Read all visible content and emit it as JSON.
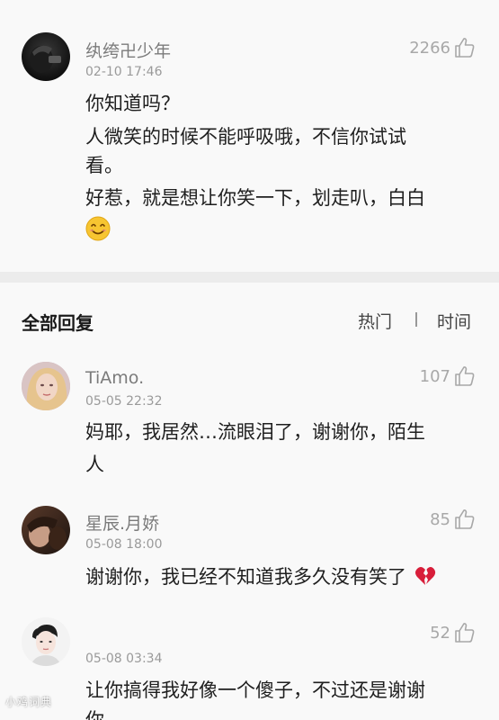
{
  "featured_comment": {
    "username": "纨绔卍少年",
    "timestamp": "02-10 17:46",
    "likes": "2266",
    "lines": [
      "你知道吗？",
      "人微笑的时候不能呼吸哦，不信你试试",
      "看。",
      "好惹，就是想让你笑一下，划走叭，白白"
    ],
    "emoji": "smile-emoji"
  },
  "section": {
    "title": "全部回复",
    "sort_hot": "热门",
    "sort_time": "时间"
  },
  "replies": [
    {
      "username": "TiAmo.",
      "timestamp": "05-05 22:32",
      "likes": "107",
      "lines": [
        "妈耶，我居然…流眼泪了，谢谢你，陌生",
        "人"
      ]
    },
    {
      "username": "星辰.月娇",
      "timestamp": "05-08 18:00",
      "likes": "85",
      "lines": [
        "谢谢你，我已经不知道我多久没有笑了"
      ],
      "emoji": "broken-heart-emoji"
    },
    {
      "username": "",
      "timestamp": "05-08 03:34",
      "likes": "52",
      "lines": [
        "让你搞得我好像一个傻子，不过还是谢谢",
        "你"
      ]
    }
  ],
  "watermark": "小鸡词典",
  "colors": {
    "background": "#f9f9f9",
    "divider": "#ececec",
    "muted_text": "#7b7b7b",
    "broken_heart": "#d81e3a"
  }
}
